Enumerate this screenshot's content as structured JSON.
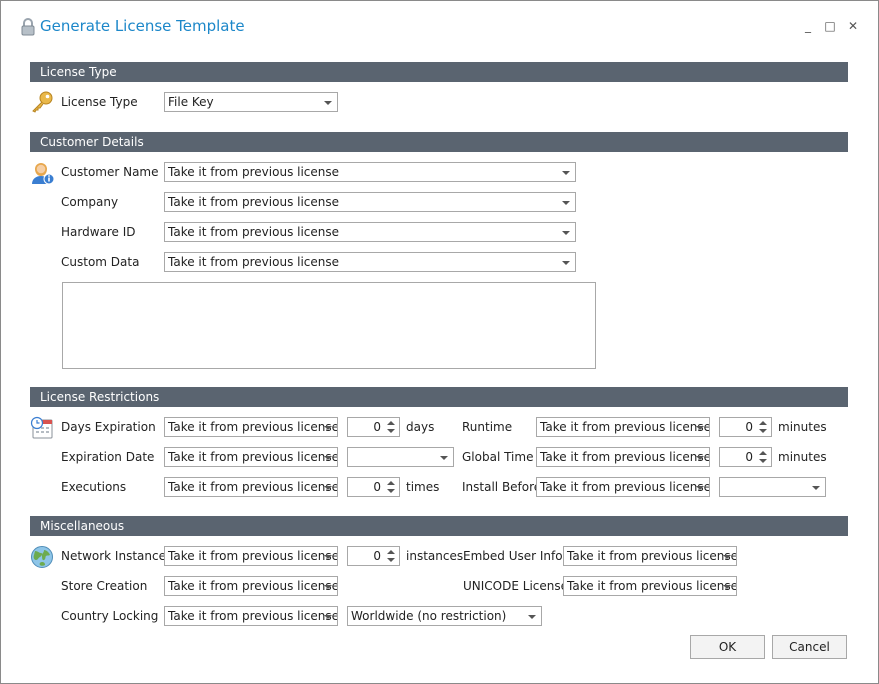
{
  "window": {
    "title": "Generate License Template",
    "minimize": "_",
    "maximize": "□",
    "close": "✕"
  },
  "sections": {
    "license_type": "License Type",
    "customer_details": "Customer Details",
    "license_restrictions": "License Restrictions",
    "miscellaneous": "Miscellaneous"
  },
  "license_type": {
    "label": "License Type",
    "value": "File Key"
  },
  "customer": {
    "name_label": "Customer Name",
    "name_value": "Take it from previous license",
    "company_label": "Company",
    "company_value": "Take it from previous license",
    "hwid_label": "Hardware ID",
    "hwid_value": "Take it from previous license",
    "custom_label": "Custom Data",
    "custom_value": "Take it from previous license"
  },
  "restrictions": {
    "days_label": "Days Expiration",
    "days_value": "Take it from previous license",
    "days_num": "0",
    "days_unit": "days",
    "expdate_label": "Expiration Date",
    "expdate_value": "Take it from previous license",
    "expdate_date": "",
    "exec_label": "Executions",
    "exec_value": "Take it from previous license",
    "exec_num": "0",
    "exec_unit": "times",
    "runtime_label": "Runtime",
    "runtime_value": "Take it from previous license",
    "runtime_num": "0",
    "runtime_unit": "minutes",
    "global_label": "Global Time",
    "global_value": "Take it from previous license",
    "global_num": "0",
    "global_unit": "minutes",
    "install_label": "Install Before",
    "install_value": "Take it from previous license",
    "install_date": ""
  },
  "misc": {
    "net_label": "Network Instances",
    "net_value": "Take it from previous license",
    "net_num": "0",
    "net_unit": "instances",
    "store_label": "Store Creation",
    "store_value": "Take it from previous license",
    "country_label": "Country Locking",
    "country_value": "Take it from previous license",
    "country_region": "Worldwide (no restriction)",
    "embed_label": "Embed User Info",
    "embed_value": "Take it from previous license",
    "unicode_label": "UNICODE License",
    "unicode_value": "Take it from previous license"
  },
  "buttons": {
    "ok": "OK",
    "cancel": "Cancel"
  },
  "icons": {
    "title": "padlock-icon",
    "key": "key-icon",
    "user": "user-info-icon",
    "calendar": "calendar-clock-icon",
    "globe": "globe-icon"
  }
}
